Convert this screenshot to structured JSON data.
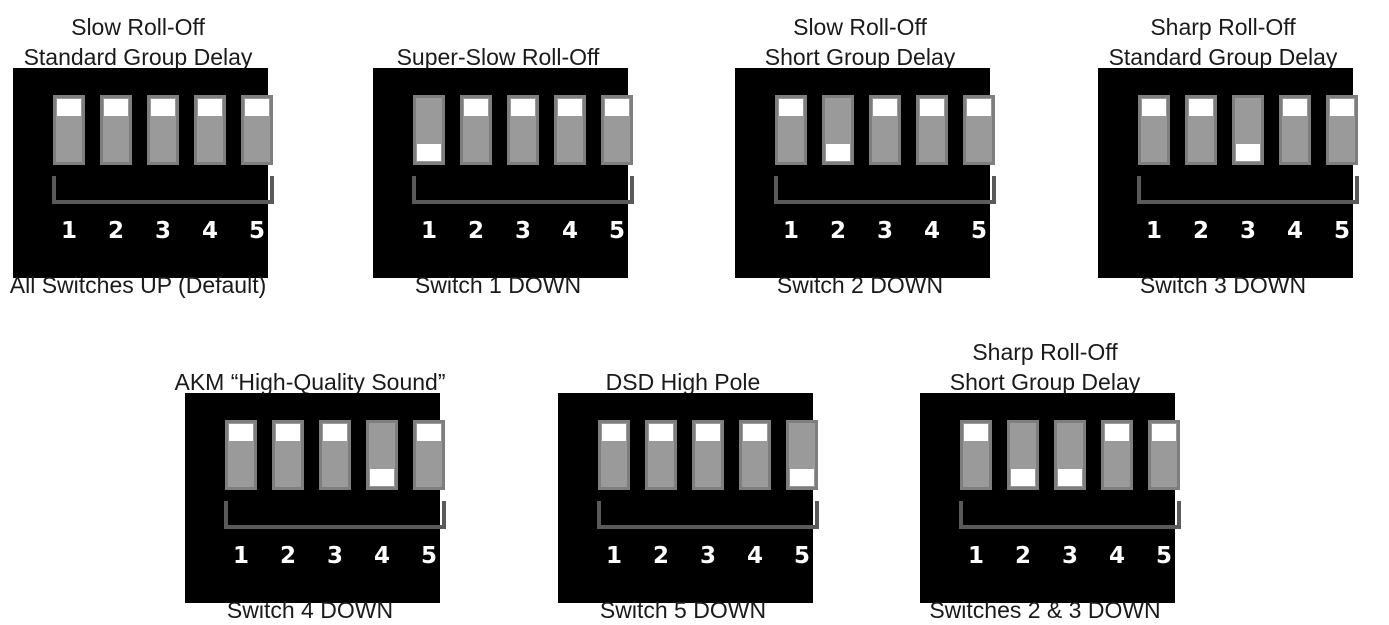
{
  "panels": [
    {
      "title": [
        "Slow Roll-Off",
        "Standard Group Delay"
      ],
      "switches": [
        "up",
        "up",
        "up",
        "up",
        "up"
      ],
      "numbers": [
        "1",
        "2",
        "3",
        "4",
        "5"
      ],
      "caption": "All Switches UP (Default)"
    },
    {
      "title": [
        "Super-Slow Roll-Off"
      ],
      "switches": [
        "down",
        "up",
        "up",
        "up",
        "up"
      ],
      "numbers": [
        "1",
        "2",
        "3",
        "4",
        "5"
      ],
      "caption": "Switch 1 DOWN"
    },
    {
      "title": [
        "Slow Roll-Off",
        "Short Group Delay"
      ],
      "switches": [
        "up",
        "down",
        "up",
        "up",
        "up"
      ],
      "numbers": [
        "1",
        "2",
        "3",
        "4",
        "5"
      ],
      "caption": "Switch 2 DOWN"
    },
    {
      "title": [
        "Sharp Roll-Off",
        "Standard Group Delay"
      ],
      "switches": [
        "up",
        "up",
        "down",
        "up",
        "up"
      ],
      "numbers": [
        "1",
        "2",
        "3",
        "4",
        "5"
      ],
      "caption": "Switch 3 DOWN"
    },
    {
      "title": [
        "AKM “High-Quality Sound”"
      ],
      "switches": [
        "up",
        "up",
        "up",
        "down",
        "up"
      ],
      "numbers": [
        "1",
        "2",
        "3",
        "4",
        "5"
      ],
      "caption": "Switch 4 DOWN"
    },
    {
      "title": [
        "DSD High Pole"
      ],
      "switches": [
        "up",
        "up",
        "up",
        "up",
        "down"
      ],
      "numbers": [
        "1",
        "2",
        "3",
        "4",
        "5"
      ],
      "caption": "Switch 5 DOWN"
    },
    {
      "title": [
        "Sharp Roll-Off",
        "Short Group Delay"
      ],
      "switches": [
        "up",
        "down",
        "down",
        "up",
        "up"
      ],
      "numbers": [
        "1",
        "2",
        "3",
        "4",
        "5"
      ],
      "caption": "Switches 2 & 3 DOWN"
    }
  ],
  "colors": {
    "panel_bg": "#000000",
    "switch_body": "#9a9a9a",
    "switch_knob": "#ffffff",
    "bracket": "#5a5a5a",
    "numbers": "#ffffff"
  }
}
